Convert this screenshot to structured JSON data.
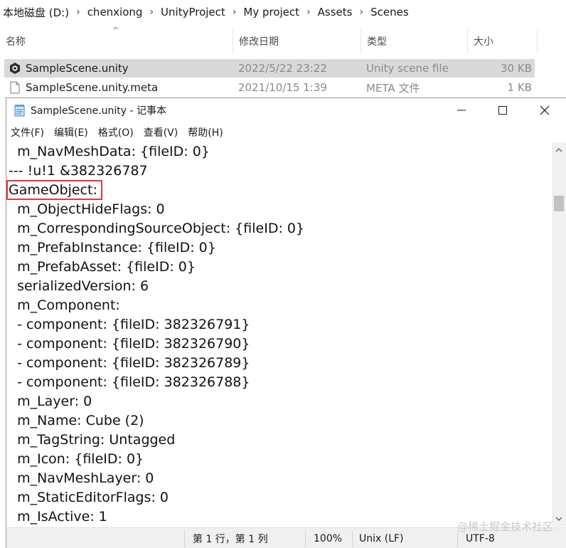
{
  "explorer": {
    "breadcrumb": [
      "本地磁盘 (D:)",
      "chenxiong",
      "UnityProject",
      "My project",
      "Assets",
      "Scenes"
    ],
    "separator": "›",
    "sort_caret": "^",
    "columns": {
      "name": "名称",
      "modified": "修改日期",
      "type": "类型",
      "size": "大小"
    },
    "files": [
      {
        "name": "SampleScene.unity",
        "modified": "2022/5/22 23:22",
        "type": "Unity scene file",
        "size": "30 KB",
        "icon": "unity-icon",
        "selected": true
      },
      {
        "name": "SampleScene.unity.meta",
        "modified": "2021/10/15 1:39",
        "type": "META 文件",
        "size": "1 KB",
        "icon": "file-icon",
        "selected": false
      }
    ]
  },
  "notepad": {
    "title": "SampleScene.unity - 记事本",
    "menu": [
      "文件(F)",
      "编辑(E)",
      "格式(O)",
      "查看(V)",
      "帮助(H)"
    ],
    "lines": [
      "  m_NavMeshData: {fileID: 0}",
      "--- !u!1 &382326787",
      "GameObject:",
      "  m_ObjectHideFlags: 0",
      "  m_CorrespondingSourceObject: {fileID: 0}",
      "  m_PrefabInstance: {fileID: 0}",
      "  m_PrefabAsset: {fileID: 0}",
      "  serializedVersion: 6",
      "  m_Component:",
      "  - component: {fileID: 382326791}",
      "  - component: {fileID: 382326790}",
      "  - component: {fileID: 382326789}",
      "  - component: {fileID: 382326788}",
      "  m_Layer: 0",
      "  m_Name: Cube (2)",
      "  m_TagString: Untagged",
      "  m_Icon: {fileID: 0}",
      "  m_NavMeshLayer: 0",
      "  m_StaticEditorFlags: 0",
      "  m_IsActive: 1"
    ],
    "status": {
      "position": "第 1 行，第 1 列",
      "zoom": "100%",
      "line_ending": "Unix (LF)",
      "encoding": "UTF-8"
    },
    "highlight_color": "#e03a3a"
  },
  "watermark": "@稀土掘金技术社区"
}
